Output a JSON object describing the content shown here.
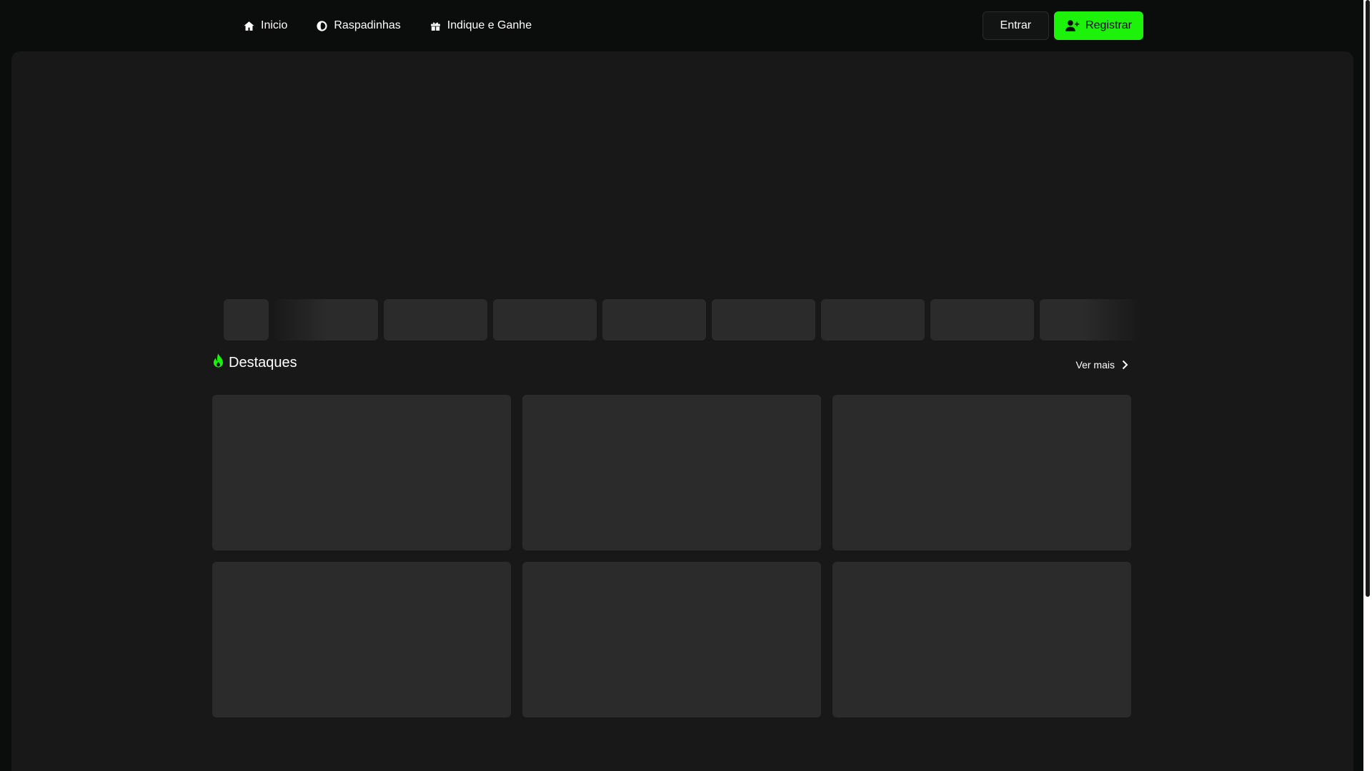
{
  "nav": {
    "items": [
      {
        "label": "Inicio",
        "icon": "home-icon"
      },
      {
        "label": "Raspadinhas",
        "icon": "coin-icon"
      },
      {
        "label": "Indique e Ganhe",
        "icon": "gift-icon"
      }
    ]
  },
  "auth": {
    "login_label": "Entrar",
    "register_label": "Registrar",
    "register_icon": "user-plus-icon"
  },
  "colors": {
    "accent": "#1cf20a",
    "background": "#0b0c0c",
    "panel": "#181818",
    "skeleton": "#2b2b2b"
  },
  "carousel": {
    "slides": 3,
    "active_index": 0
  },
  "featured": {
    "title": "Destaques",
    "title_icon": "fire-icon",
    "see_more_label": "Ver mais",
    "see_more_icon": "chevron-right-icon"
  }
}
